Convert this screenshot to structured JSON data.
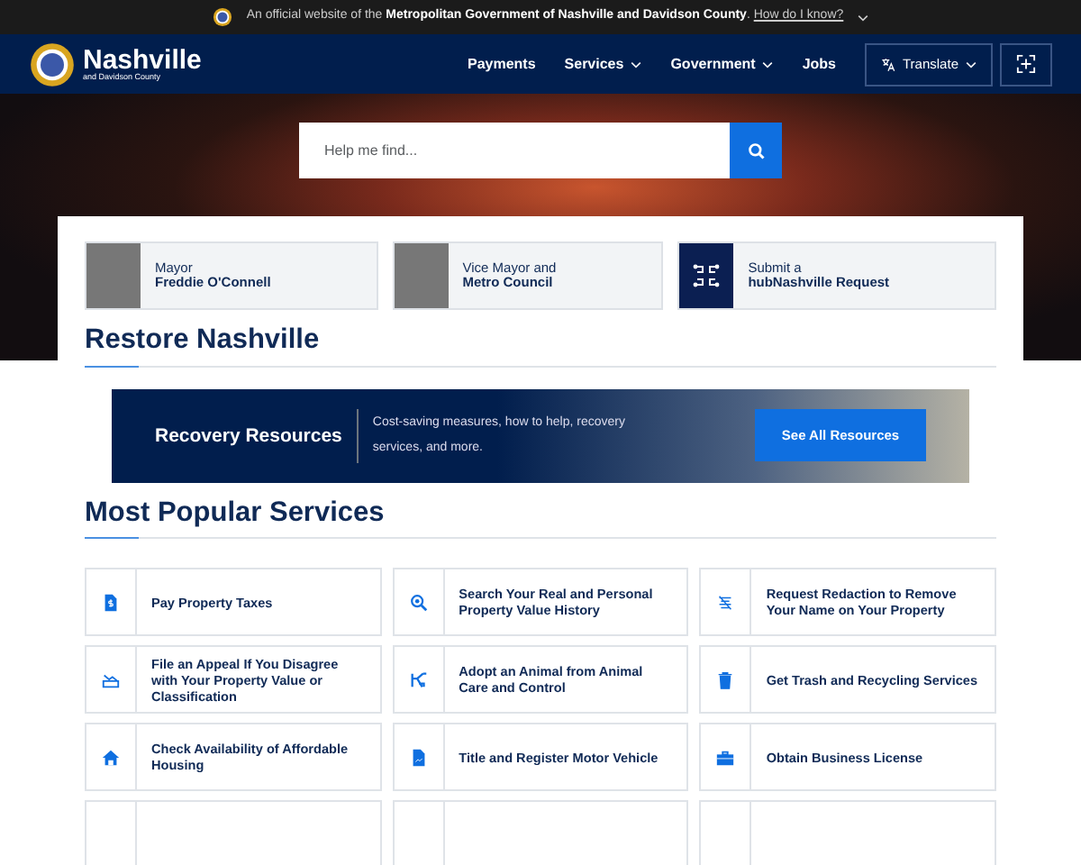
{
  "official_banner": {
    "text": "An official website of the **Metropolitan Government of Nashville and Davidson County**.",
    "link": "How do I know?"
  },
  "header": {
    "logo_title": "Nashville",
    "logo_subtitle": "and Davidson County",
    "nav": [
      {
        "label": "Payments",
        "dropdown": false
      },
      {
        "label": "Services",
        "dropdown": true
      },
      {
        "label": "Government",
        "dropdown": true
      },
      {
        "label": "Jobs",
        "dropdown": false
      }
    ],
    "translate": "Translate"
  },
  "search": {
    "placeholder": "Help me find..."
  },
  "leaders": [
    {
      "kind": "person",
      "line1": "Mayor",
      "line2": "Freddie O'Connell"
    },
    {
      "kind": "person",
      "line1": "Vice Mayor and",
      "line2": "Metro Council"
    },
    {
      "kind": "hub",
      "line1": "Submit a",
      "line2": "hubNashville Request"
    }
  ],
  "restore": {
    "heading": "Restore Nashville",
    "title": "Recovery Resources",
    "text": "Cost-saving measures, how to help, recovery services, and more.",
    "button": "See All Resources"
  },
  "services": {
    "heading": "Most Popular Services",
    "items": [
      {
        "kind": "service",
        "label": "Pay Property Taxes"
      },
      {
        "kind": "service",
        "label": "Search Your Real and Personal Property Value History"
      },
      {
        "kind": "service",
        "label": "Request Redaction to Remove Your Name on Your Property"
      },
      {
        "kind": "service",
        "label": "File an Appeal If You Disagree with Your Property Value or Classification"
      },
      {
        "kind": "service",
        "label": "Adopt an Animal from Animal Care and Control"
      },
      {
        "kind": "service",
        "label": "Get Trash and Recycling Services"
      },
      {
        "kind": "service",
        "label": "Check Availability of Affordable Housing"
      },
      {
        "kind": "service",
        "label": "Title and Register Motor Vehicle"
      },
      {
        "kind": "service",
        "label": "Obtain Business License"
      },
      {
        "kind": "cut_off"
      },
      {
        "kind": "cut_off"
      },
      {
        "kind": "cut_off"
      }
    ]
  }
}
